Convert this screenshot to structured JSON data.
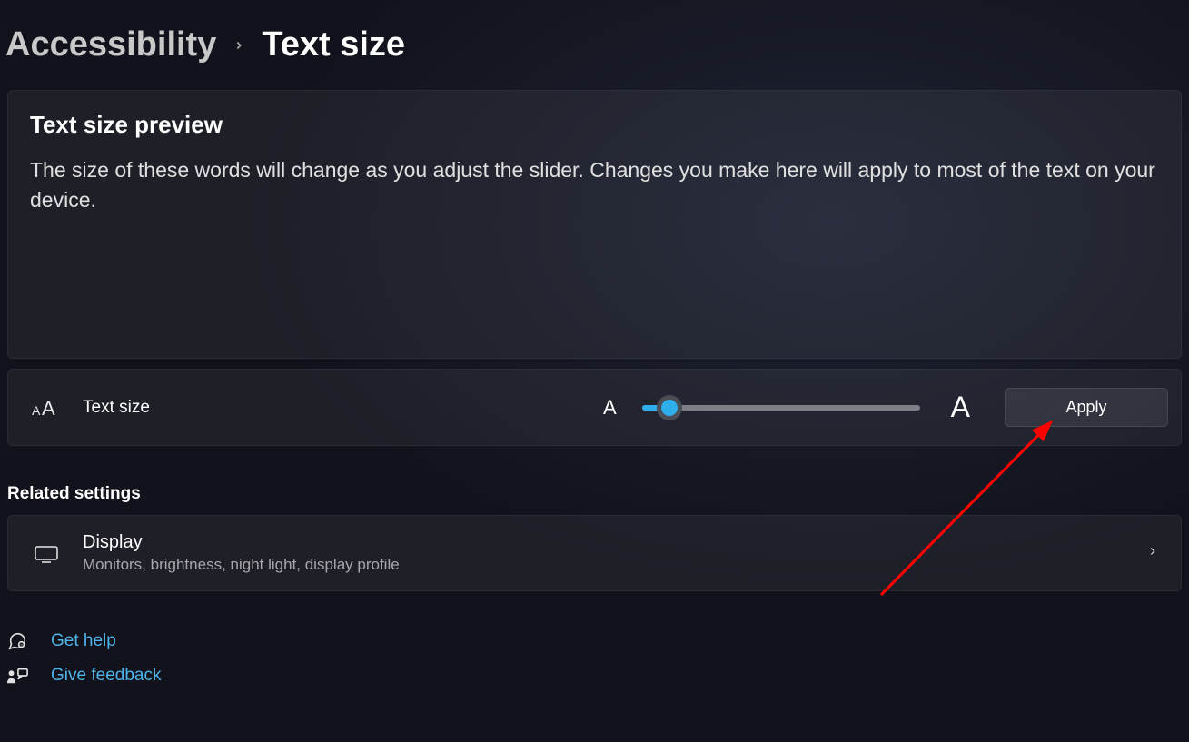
{
  "breadcrumb": {
    "parent": "Accessibility",
    "current": "Text size"
  },
  "preview": {
    "title": "Text size preview",
    "body": "The size of these words will change as you adjust the slider. Changes you make here will apply to most of the text on your device."
  },
  "slider": {
    "label": "Text size",
    "small_marker": "A",
    "large_marker": "A",
    "value_percent": 10,
    "apply_label": "Apply"
  },
  "related": {
    "heading": "Related settings",
    "display": {
      "title": "Display",
      "desc": "Monitors, brightness, night light, display profile"
    }
  },
  "links": {
    "help": "Get help",
    "feedback": "Give feedback"
  }
}
